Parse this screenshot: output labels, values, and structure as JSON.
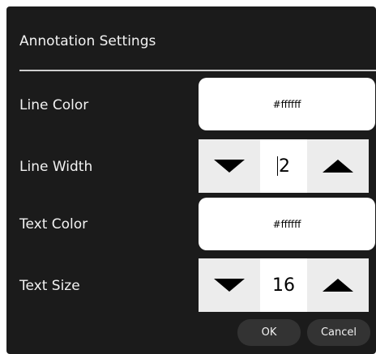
{
  "dialog": {
    "title": "Annotation Settings",
    "colors": {
      "background": "#1b1b1b",
      "text": "#f2f2f2",
      "divider": "#cfcfcf",
      "field": "#ffffff",
      "stepper_button": "#ececec",
      "action_button": "#333333"
    }
  },
  "settings": {
    "line_color": {
      "label": "Line Color",
      "value": "#ffffff"
    },
    "line_width": {
      "label": "Line Width",
      "value": "2"
    },
    "text_color": {
      "label": "Text Color",
      "value": "#ffffff"
    },
    "text_size": {
      "label": "Text Size",
      "value": "16"
    }
  },
  "icons": {
    "decrement": "triangle-down-icon",
    "increment": "triangle-up-icon"
  },
  "actions": {
    "ok_label": "OK",
    "cancel_label": "Cancel"
  }
}
